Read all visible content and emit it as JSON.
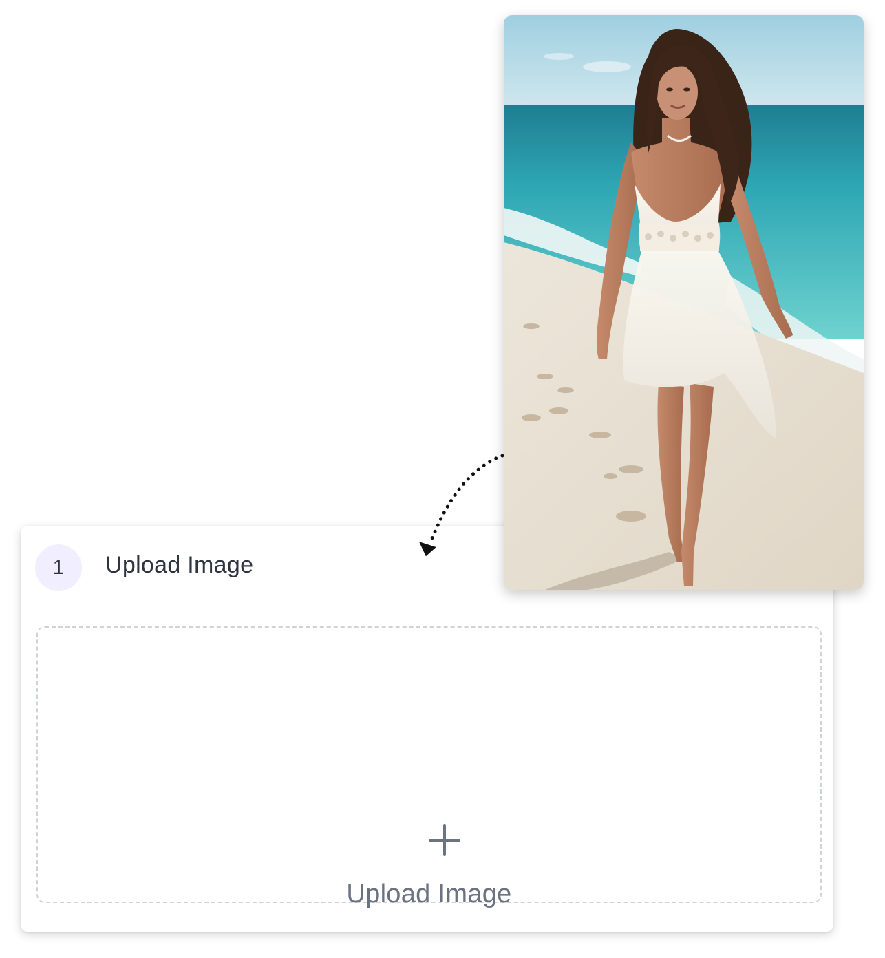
{
  "upload_card": {
    "step_number": "1",
    "title": "Upload Image",
    "dropzone": {
      "icon": "plus-icon",
      "label": "Upload Image"
    }
  },
  "example_image": {
    "subject": "beach-photo"
  },
  "colors": {
    "badge_bg": "#f1efff",
    "text_dark": "#2f3441",
    "text_muted": "#6b7280",
    "dash_border": "#cfd3d8"
  }
}
